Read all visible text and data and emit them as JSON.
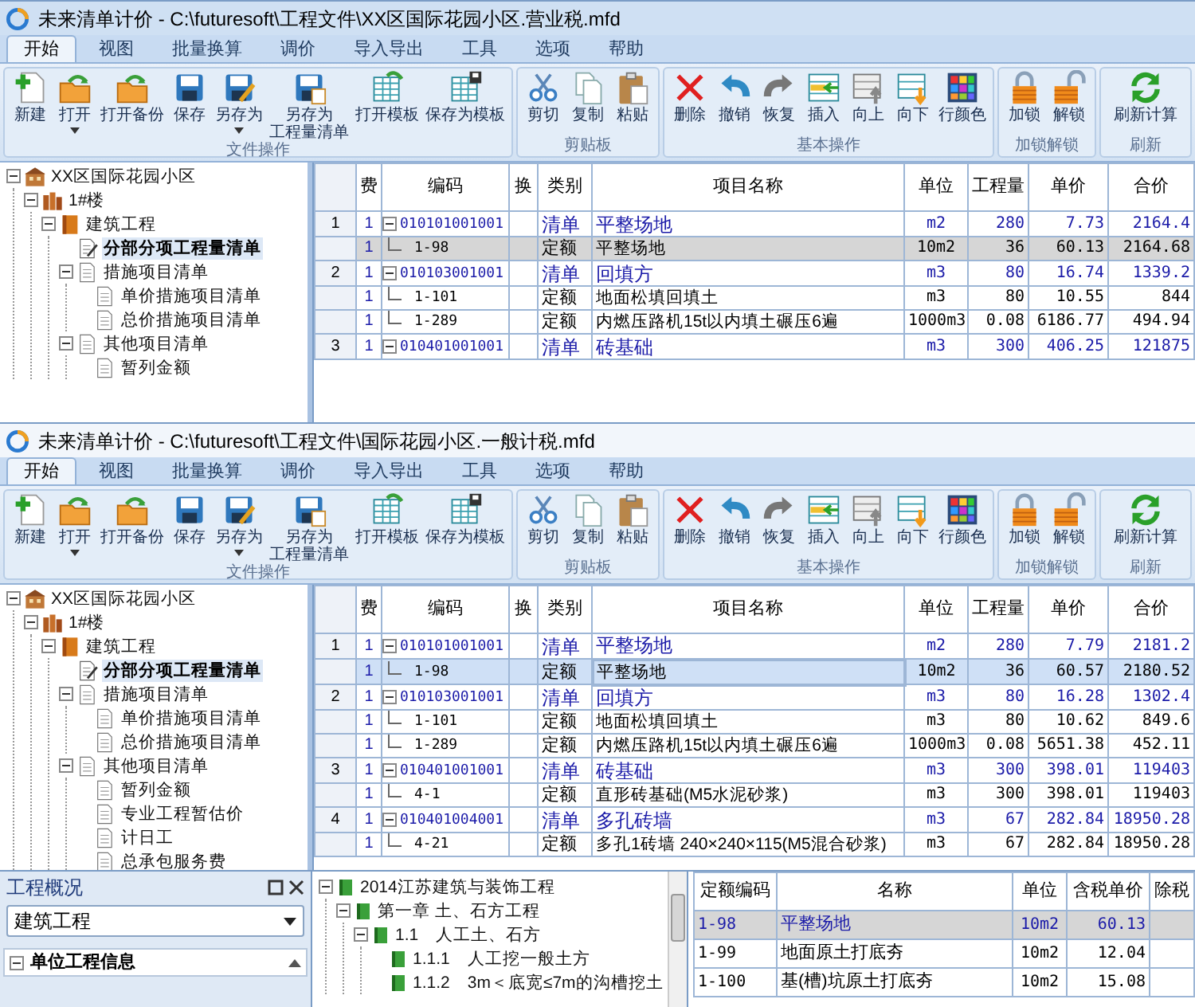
{
  "windows": [
    {
      "title": "未来清单计价 - C:\\futuresoft\\工程文件\\XX区国际花园小区.营业税.mfd",
      "tabs": [
        {
          "label": "开始",
          "selected": true
        },
        {
          "label": "视图",
          "selected": false
        },
        {
          "label": "批量换算",
          "selected": false
        },
        {
          "label": "调价",
          "selected": false
        },
        {
          "label": "导入导出",
          "selected": false
        },
        {
          "label": "工具",
          "selected": false
        },
        {
          "label": "选项",
          "selected": false
        },
        {
          "label": "帮助",
          "selected": false
        }
      ],
      "ribbon_groups": [
        {
          "label": "文件操作",
          "buttons": [
            {
              "kind": "new",
              "label": "新建",
              "dropdown": false
            },
            {
              "kind": "open",
              "label": "打开",
              "dropdown": true
            },
            {
              "kind": "backup",
              "label": "打开备份",
              "dropdown": false
            },
            {
              "kind": "save",
              "label": "保存",
              "dropdown": false
            },
            {
              "kind": "saveas",
              "label": "另存为",
              "dropdown": true
            },
            {
              "kind": "savelist",
              "label": "另存为",
              "label_2": "工程量清单",
              "dropdown": false
            },
            {
              "kind": "opentpl",
              "label": "打开模板",
              "dropdown": false
            },
            {
              "kind": "savetpl",
              "label": "保存为模板",
              "dropdown": false
            }
          ]
        },
        {
          "label": "剪贴板",
          "buttons": [
            {
              "kind": "cut",
              "label": "剪切",
              "dropdown": false
            },
            {
              "kind": "copy",
              "label": "复制",
              "dropdown": false
            },
            {
              "kind": "paste",
              "label": "粘贴",
              "dropdown": false
            }
          ]
        },
        {
          "label": "基本操作",
          "buttons": [
            {
              "kind": "delete",
              "label": "删除",
              "dropdown": false
            },
            {
              "kind": "undo",
              "label": "撤销",
              "dropdown": false
            },
            {
              "kind": "redo",
              "label": "恢复",
              "dropdown": false
            },
            {
              "kind": "insert",
              "label": "插入",
              "dropdown": false
            },
            {
              "kind": "up",
              "label": "向上",
              "dropdown": false
            },
            {
              "kind": "down",
              "label": "向下",
              "dropdown": false
            },
            {
              "kind": "color",
              "label": "行颜色",
              "dropdown": false
            }
          ]
        },
        {
          "label": "加锁解锁",
          "buttons": [
            {
              "kind": "lock",
              "label": "加锁",
              "dropdown": false
            },
            {
              "kind": "unlock",
              "label": "解锁",
              "dropdown": false
            }
          ]
        },
        {
          "label": "刷新",
          "buttons": [
            {
              "kind": "refresh",
              "label": "刷新计算",
              "dropdown": false
            }
          ]
        }
      ],
      "tree": [
        {
          "label": "XX区国际花园小区",
          "kind": "project",
          "selected": false,
          "expanded": true,
          "children": [
            {
              "label": "1#楼",
              "kind": "building",
              "selected": false,
              "expanded": true,
              "children": [
                {
                  "label": "建筑工程",
                  "kind": "unit",
                  "selected": false,
                  "expanded": true,
                  "children": [
                    {
                      "label": "分部分项工程量清单",
                      "kind": "edit",
                      "selected": true
                    },
                    {
                      "label": "措施项目清单",
                      "kind": "doc",
                      "selected": false,
                      "expanded": true,
                      "children": [
                        {
                          "label": "单价措施项目清单",
                          "kind": "doc",
                          "selected": false
                        },
                        {
                          "label": "总价措施项目清单",
                          "kind": "doc",
                          "selected": false
                        }
                      ]
                    },
                    {
                      "label": "其他项目清单",
                      "kind": "doc",
                      "selected": false,
                      "expanded": true,
                      "children": [
                        {
                          "label": "暂列金额",
                          "kind": "doc",
                          "selected": false
                        }
                      ]
                    }
                  ]
                }
              ]
            }
          ]
        }
      ],
      "table": {
        "columns": [
          "费",
          "编码",
          "换",
          "类别",
          "项目名称",
          "单位",
          "工程量",
          "单价",
          "合价"
        ],
        "rows": [
          {
            "kind": "bill",
            "number": "1",
            "fee": "1",
            "code": "010101001001",
            "type": "清单",
            "name": "平整场地",
            "unit": "m2",
            "quantity": "280",
            "price": "7.73",
            "total": "2164.4",
            "selected": false
          },
          {
            "kind": "quota",
            "fee": "1",
            "code": "1-98",
            "type": "定额",
            "name": "平整场地",
            "unit": "10m2",
            "quantity": "36",
            "price": "60.13",
            "total": "2164.68",
            "selected": true
          },
          {
            "kind": "bill",
            "number": "2",
            "fee": "1",
            "code": "010103001001",
            "type": "清单",
            "name": "回填方",
            "unit": "m3",
            "quantity": "80",
            "price": "16.74",
            "total": "1339.2",
            "selected": false
          },
          {
            "kind": "quota",
            "fee": "1",
            "code": "1-101",
            "type": "定额",
            "name": "地面松填回填土",
            "unit": "m3",
            "quantity": "80",
            "price": "10.55",
            "total": "844",
            "selected": false
          },
          {
            "kind": "quota",
            "fee": "1",
            "code": "1-289",
            "type": "定额",
            "name": "内燃压路机15t以内填土碾压6遍",
            "unit": "1000m3",
            "quantity": "0.08",
            "price": "6186.77",
            "total": "494.94",
            "selected": false
          },
          {
            "kind": "bill",
            "number": "3",
            "fee": "1",
            "code": "010401001001",
            "type": "清单",
            "name": "砖基础",
            "unit": "m3",
            "quantity": "300",
            "price": "406.25",
            "total": "121875",
            "selected": false
          }
        ]
      }
    },
    {
      "title": "未来清单计价 - C:\\futuresoft\\工程文件\\国际花园小区.一般计税.mfd",
      "tabs": [
        {
          "label": "开始",
          "selected": true
        },
        {
          "label": "视图",
          "selected": false
        },
        {
          "label": "批量换算",
          "selected": false
        },
        {
          "label": "调价",
          "selected": false
        },
        {
          "label": "导入导出",
          "selected": false
        },
        {
          "label": "工具",
          "selected": false
        },
        {
          "label": "选项",
          "selected": false
        },
        {
          "label": "帮助",
          "selected": false
        }
      ],
      "ribbon_groups": [
        {
          "label": "文件操作",
          "buttons": [
            {
              "kind": "new",
              "label": "新建",
              "dropdown": false
            },
            {
              "kind": "open",
              "label": "打开",
              "dropdown": true
            },
            {
              "kind": "backup",
              "label": "打开备份",
              "dropdown": false
            },
            {
              "kind": "save",
              "label": "保存",
              "dropdown": false
            },
            {
              "kind": "saveas",
              "label": "另存为",
              "dropdown": true
            },
            {
              "kind": "savelist",
              "label": "另存为",
              "label_2": "工程量清单",
              "dropdown": false
            },
            {
              "kind": "opentpl",
              "label": "打开模板",
              "dropdown": false
            },
            {
              "kind": "savetpl",
              "label": "保存为模板",
              "dropdown": false
            }
          ]
        },
        {
          "label": "剪贴板",
          "buttons": [
            {
              "kind": "cut",
              "label": "剪切",
              "dropdown": false
            },
            {
              "kind": "copy",
              "label": "复制",
              "dropdown": false
            },
            {
              "kind": "paste",
              "label": "粘贴",
              "dropdown": false
            }
          ]
        },
        {
          "label": "基本操作",
          "buttons": [
            {
              "kind": "delete",
              "label": "删除",
              "dropdown": false
            },
            {
              "kind": "undo",
              "label": "撤销",
              "dropdown": false
            },
            {
              "kind": "redo",
              "label": "恢复",
              "dropdown": false
            },
            {
              "kind": "insert",
              "label": "插入",
              "dropdown": false
            },
            {
              "kind": "up",
              "label": "向上",
              "dropdown": false
            },
            {
              "kind": "down",
              "label": "向下",
              "dropdown": false
            },
            {
              "kind": "color",
              "label": "行颜色",
              "dropdown": false
            }
          ]
        },
        {
          "label": "加锁解锁",
          "buttons": [
            {
              "kind": "lock",
              "label": "加锁",
              "dropdown": false
            },
            {
              "kind": "unlock",
              "label": "解锁",
              "dropdown": false
            }
          ]
        },
        {
          "label": "刷新",
          "buttons": [
            {
              "kind": "refresh",
              "label": "刷新计算",
              "dropdown": false
            }
          ]
        }
      ],
      "tree": [
        {
          "label": "XX区国际花园小区",
          "kind": "project",
          "selected": false,
          "expanded": true,
          "children": [
            {
              "label": "1#楼",
              "kind": "building",
              "selected": false,
              "expanded": true,
              "children": [
                {
                  "label": "建筑工程",
                  "kind": "unit",
                  "selected": false,
                  "expanded": true,
                  "children": [
                    {
                      "label": "分部分项工程量清单",
                      "kind": "edit",
                      "selected": true
                    },
                    {
                      "label": "措施项目清单",
                      "kind": "doc",
                      "selected": false,
                      "expanded": true,
                      "children": [
                        {
                          "label": "单价措施项目清单",
                          "kind": "doc",
                          "selected": false
                        },
                        {
                          "label": "总价措施项目清单",
                          "kind": "doc",
                          "selected": false
                        }
                      ]
                    },
                    {
                      "label": "其他项目清单",
                      "kind": "doc",
                      "selected": false,
                      "expanded": true,
                      "children": [
                        {
                          "label": "暂列金额",
                          "kind": "doc",
                          "selected": false
                        },
                        {
                          "label": "专业工程暂估价",
                          "kind": "doc",
                          "selected": false
                        },
                        {
                          "label": "计日工",
                          "kind": "doc",
                          "selected": false
                        },
                        {
                          "label": "总承包服务费",
                          "kind": "doc",
                          "selected": false
                        }
                      ]
                    }
                  ]
                }
              ]
            }
          ]
        }
      ],
      "table": {
        "columns": [
          "费",
          "编码",
          "换",
          "类别",
          "项目名称",
          "单位",
          "工程量",
          "单价",
          "合价"
        ],
        "rows": [
          {
            "kind": "bill",
            "number": "1",
            "fee": "1",
            "code": "010101001001",
            "type": "清单",
            "name": "平整场地",
            "unit": "m2",
            "quantity": "280",
            "price": "7.79",
            "total": "2181.2",
            "selected": false
          },
          {
            "kind": "quota",
            "fee": "1",
            "code": "1-98",
            "type": "定额",
            "name": "平整场地",
            "unit": "10m2",
            "quantity": "36",
            "price": "60.57",
            "total": "2180.52",
            "selected": true
          },
          {
            "kind": "bill",
            "number": "2",
            "fee": "1",
            "code": "010103001001",
            "type": "清单",
            "name": "回填方",
            "unit": "m3",
            "quantity": "80",
            "price": "16.28",
            "total": "1302.4",
            "selected": false
          },
          {
            "kind": "quota",
            "fee": "1",
            "code": "1-101",
            "type": "定额",
            "name": "地面松填回填土",
            "unit": "m3",
            "quantity": "80",
            "price": "10.62",
            "total": "849.6",
            "selected": false
          },
          {
            "kind": "quota",
            "fee": "1",
            "code": "1-289",
            "type": "定额",
            "name": "内燃压路机15t以内填土碾压6遍",
            "unit": "1000m3",
            "quantity": "0.08",
            "price": "5651.38",
            "total": "452.11",
            "selected": false
          },
          {
            "kind": "bill",
            "number": "3",
            "fee": "1",
            "code": "010401001001",
            "type": "清单",
            "name": "砖基础",
            "unit": "m3",
            "quantity": "300",
            "price": "398.01",
            "total": "119403",
            "selected": false
          },
          {
            "kind": "quota",
            "fee": "1",
            "code": "4-1",
            "type": "定额",
            "name": "直形砖基础(M5水泥砂浆)",
            "unit": "m3",
            "quantity": "300",
            "price": "398.01",
            "total": "119403",
            "selected": false
          },
          {
            "kind": "bill",
            "number": "4",
            "fee": "1",
            "code": "010401004001",
            "type": "清单",
            "name": "多孔砖墙",
            "unit": "m3",
            "quantity": "67",
            "price": "282.84",
            "total": "18950.28",
            "selected": false
          },
          {
            "kind": "quota",
            "fee": "1",
            "code": "4-21",
            "type": "定额",
            "name": "多孔1砖墙 240×240×115(M5混合砂浆)",
            "unit": "m3",
            "quantity": "67",
            "price": "282.84",
            "total": "18950.28",
            "selected": false
          }
        ]
      },
      "overview_panel": {
        "title": "工程概况",
        "dropdown": "建筑工程",
        "section": "单位工程信息",
        "section_expanded": true
      },
      "library_tree": [
        {
          "label": "2014江苏建筑与装饰工程",
          "expanded": true,
          "selected": false,
          "children": [
            {
              "label": "第一章 土、石方工程",
              "expanded": true,
              "selected": false,
              "children": [
                {
                  "label": "1.1　人工土、石方",
                  "expanded": true,
                  "selected": false,
                  "children": [
                    {
                      "label": "1.1.1　人工挖一般土方",
                      "selected": false
                    },
                    {
                      "label": "1.1.2　3m＜底宽≤7m的沟槽挖土",
                      "selected": false
                    }
                  ]
                }
              ]
            }
          ]
        }
      ],
      "quota_table": {
        "columns": [
          "定额编码",
          "名称",
          "单位",
          "含税单价",
          "除税"
        ],
        "rows": [
          {
            "code": "1-98",
            "name": "平整场地",
            "unit": "10m2",
            "price": "60.13",
            "selected": true
          },
          {
            "code": "1-99",
            "name": "地面原土打底夯",
            "unit": "10m2",
            "price": "12.04",
            "selected": false
          },
          {
            "code": "1-100",
            "name": "基(槽)坑原土打底夯",
            "unit": "10m2",
            "price": "15.08",
            "selected": false
          }
        ]
      }
    }
  ]
}
